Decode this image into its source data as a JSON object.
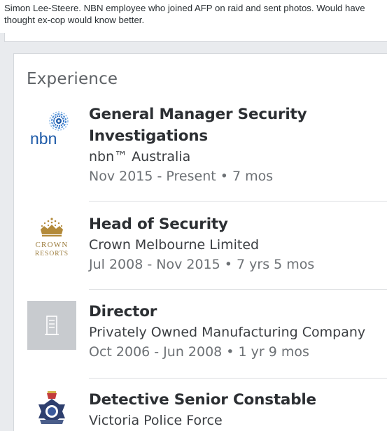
{
  "tweet": {
    "text": "Simon Lee-Steere. NBN employee who joined AFP on raid and sent photos. Would have thought ex-cop would know better."
  },
  "section": {
    "title": "Experience"
  },
  "experience": [
    {
      "title_line1": "General Manager Security",
      "title_line2": "Investigations",
      "company": "nbn™ Australia",
      "dates": "Nov 2015 - Present • 7 mos",
      "logo_text": "nbn"
    },
    {
      "title_line1": "Head of Security",
      "company": "Crown Melbourne Limited",
      "dates": "Jul 2008 - Nov 2015 • 7 yrs 5 mos",
      "logo_text_1": "CROWN",
      "logo_text_2": "RESORTS"
    },
    {
      "title_line1": "Director",
      "company": "Privately Owned Manufacturing Company",
      "dates": "Oct 2006 - Jun 2008 • 1 yr 9 mos"
    },
    {
      "title_line1": "Detective Senior Constable",
      "company": "Victoria Police Force"
    }
  ],
  "colors": {
    "nbn_blue": "#1d5aa8",
    "crown_gold": "#b38a3a",
    "placeholder_grey": "#c8cbcf"
  }
}
